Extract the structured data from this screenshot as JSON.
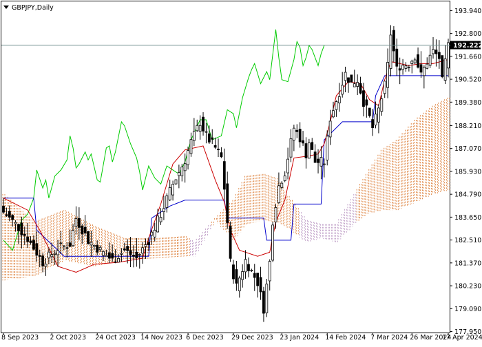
{
  "chart_title": "GBPJPY,Daily",
  "colors": {
    "background": "#ffffff",
    "candle": "#000000",
    "tenkan": "#cc0000",
    "kijun": "#0000cc",
    "chikou": "#00cc00",
    "kumo_bull": "#e08a4a",
    "kumo_bear": "#c0a0c8",
    "price_line": "#6a8a8a"
  },
  "chart_data": {
    "type": "candlestick",
    "symbol": "GBPJPY",
    "timeframe": "Daily",
    "indicators": [
      "Ichimoku Kinko Hyo"
    ],
    "ylim": [
      177.9,
      194.4
    ],
    "y_ticks": [
      "193.940",
      "192.800",
      "191.660",
      "190.520",
      "189.380",
      "188.210",
      "187.070",
      "185.930",
      "184.790",
      "183.650",
      "182.510",
      "181.370",
      "180.230",
      "179.090",
      "177.950"
    ],
    "x_ticks": [
      "8 Sep 2023",
      "2 Oct 2023",
      "24 Oct 2023",
      "14 Nov 2023",
      "6 Dec 2023",
      "29 Dec 2023",
      "23 Jan 2024",
      "14 Feb 2024",
      "7 Mar 2024",
      "26 Mar 2024",
      "17 Apr 2024"
    ],
    "current_price": "192.222",
    "close_path": [
      [
        0,
        183.9
      ],
      [
        4,
        183.3
      ],
      [
        8,
        182.6
      ],
      [
        13,
        181.4
      ],
      [
        18,
        182.1
      ],
      [
        22,
        182.3
      ],
      [
        24,
        183.6
      ],
      [
        28,
        182.5
      ],
      [
        32,
        182.0
      ],
      [
        36,
        181.5
      ],
      [
        40,
        182.0
      ],
      [
        44,
        181.6
      ],
      [
        48,
        182.5
      ],
      [
        52,
        183.8
      ],
      [
        56,
        185.3
      ],
      [
        60,
        186.5
      ],
      [
        62,
        187.4
      ],
      [
        65,
        188.4
      ],
      [
        67,
        187.7
      ],
      [
        70,
        187.1
      ],
      [
        72,
        186.6
      ],
      [
        73,
        185.1
      ],
      [
        74,
        183.4
      ],
      [
        75,
        181.4
      ],
      [
        77,
        180.2
      ],
      [
        80,
        181.5
      ],
      [
        84,
        180.4
      ],
      [
        86,
        179.1
      ],
      [
        88,
        181.4
      ],
      [
        89,
        183.5
      ],
      [
        91,
        185.2
      ],
      [
        93,
        185.9
      ],
      [
        96,
        188.1
      ],
      [
        98,
        187.6
      ],
      [
        100,
        186.8
      ],
      [
        101,
        187.4
      ],
      [
        103,
        186.4
      ],
      [
        106,
        186.4
      ],
      [
        108,
        188.6
      ],
      [
        111,
        189.9
      ],
      [
        113,
        190.8
      ],
      [
        115,
        190.3
      ],
      [
        117,
        190.5
      ],
      [
        119,
        189.4
      ],
      [
        121,
        188.6
      ],
      [
        122,
        188.1
      ],
      [
        124,
        189.0
      ],
      [
        126,
        190.2
      ],
      [
        127,
        191.2
      ],
      [
        128,
        192.8
      ],
      [
        130,
        191.0
      ],
      [
        131,
        191.2
      ],
      [
        134,
        191.3
      ],
      [
        136,
        191.7
      ],
      [
        138,
        190.7
      ],
      [
        140,
        191.4
      ],
      [
        142,
        191.9
      ],
      [
        144,
        191.6
      ],
      [
        145,
        190.4
      ],
      [
        147,
        192.2
      ]
    ],
    "kijun_path": [
      [
        0,
        184.6
      ],
      [
        10,
        184.6
      ],
      [
        11,
        183.0
      ],
      [
        18,
        182.0
      ],
      [
        20,
        181.7
      ],
      [
        30,
        181.7
      ],
      [
        40,
        181.7
      ],
      [
        48,
        181.7
      ],
      [
        49,
        183.6
      ],
      [
        55,
        184.2
      ],
      [
        60,
        184.5
      ],
      [
        73,
        184.5
      ],
      [
        74,
        183.6
      ],
      [
        86,
        183.6
      ],
      [
        87,
        182.5
      ],
      [
        95,
        182.5
      ],
      [
        96,
        184.3
      ],
      [
        105,
        184.3
      ],
      [
        106,
        187.5
      ],
      [
        112,
        188.4
      ],
      [
        118,
        188.4
      ],
      [
        122,
        188.4
      ],
      [
        123,
        189.7
      ],
      [
        126,
        190.7
      ],
      [
        147,
        190.7
      ]
    ],
    "tenkan_path": [
      [
        0,
        184.6
      ],
      [
        8,
        184.0
      ],
      [
        12,
        183.0
      ],
      [
        18,
        181.2
      ],
      [
        24,
        180.9
      ],
      [
        30,
        181.3
      ],
      [
        38,
        181.4
      ],
      [
        46,
        181.6
      ],
      [
        48,
        182.6
      ],
      [
        52,
        184.3
      ],
      [
        56,
        186.3
      ],
      [
        60,
        187.0
      ],
      [
        66,
        187.2
      ],
      [
        70,
        185.5
      ],
      [
        73,
        184.4
      ],
      [
        75,
        183.0
      ],
      [
        78,
        182.0
      ],
      [
        84,
        181.7
      ],
      [
        88,
        181.9
      ],
      [
        90,
        183.4
      ],
      [
        93,
        184.5
      ],
      [
        96,
        186.6
      ],
      [
        101,
        186.7
      ],
      [
        104,
        186.8
      ],
      [
        106,
        187.3
      ],
      [
        108,
        188.4
      ],
      [
        110,
        189.7
      ],
      [
        114,
        190.4
      ],
      [
        118,
        190.3
      ],
      [
        121,
        189.5
      ],
      [
        124,
        189.2
      ],
      [
        126,
        190.5
      ],
      [
        128,
        191.4
      ],
      [
        134,
        191.2
      ],
      [
        138,
        191.3
      ],
      [
        142,
        191.3
      ],
      [
        147,
        191.5
      ]
    ],
    "chikou_path": [
      [
        0,
        182.5
      ],
      [
        3,
        182.0
      ],
      [
        6,
        183.5
      ],
      [
        8,
        183.8
      ],
      [
        10,
        184.6
      ],
      [
        11,
        186.0
      ],
      [
        13,
        185.1
      ],
      [
        14,
        185.5
      ],
      [
        15,
        184.6
      ],
      [
        17,
        185.7
      ],
      [
        19,
        186.0
      ],
      [
        21,
        186.5
      ],
      [
        22,
        187.7
      ],
      [
        23,
        187.1
      ],
      [
        24,
        186.1
      ],
      [
        25,
        186.3
      ],
      [
        27,
        186.9
      ],
      [
        28,
        186.5
      ],
      [
        29,
        186.8
      ],
      [
        31,
        185.5
      ],
      [
        32,
        185.4
      ],
      [
        34,
        187.1
      ],
      [
        35,
        187.2
      ],
      [
        36,
        186.4
      ],
      [
        37,
        186.9
      ],
      [
        39,
        188.4
      ],
      [
        40,
        188.2
      ],
      [
        42,
        187.3
      ],
      [
        44,
        186.6
      ],
      [
        45,
        185.9
      ],
      [
        46,
        185.0
      ],
      [
        48,
        186.2
      ],
      [
        50,
        185.6
      ],
      [
        52,
        185.3
      ],
      [
        54,
        186.2
      ],
      [
        56,
        186.0
      ],
      [
        58,
        185.8
      ],
      [
        60,
        186.4
      ],
      [
        62,
        187.5
      ],
      [
        65,
        188.5
      ],
      [
        67,
        188.5
      ],
      [
        69,
        187.5
      ],
      [
        72,
        187.7
      ],
      [
        74,
        189.0
      ],
      [
        76,
        188.8
      ],
      [
        77,
        188.1
      ],
      [
        79,
        189.6
      ],
      [
        81,
        190.6
      ],
      [
        82,
        191.0
      ],
      [
        83,
        191.3
      ],
      [
        85,
        190.3
      ],
      [
        87,
        190.9
      ],
      [
        88,
        190.5
      ],
      [
        90,
        193.0
      ],
      [
        91,
        191.6
      ],
      [
        92,
        190.5
      ],
      [
        94,
        190.4
      ],
      [
        96,
        191.5
      ],
      [
        97,
        192.4
      ],
      [
        98,
        192.1
      ],
      [
        99,
        191.2
      ],
      [
        100,
        191.6
      ],
      [
        101,
        192.2
      ],
      [
        102,
        192.0
      ],
      [
        104,
        191.2
      ],
      [
        105,
        191.8
      ],
      [
        106,
        192.2
      ]
    ],
    "cloud_path": [
      [
        0,
        180.5,
        184.8
      ],
      [
        10,
        180.7,
        183.4
      ],
      [
        20,
        181.5,
        184.0
      ],
      [
        30,
        181.2,
        183.2
      ],
      [
        40,
        181.5,
        182.6
      ],
      [
        50,
        181.6,
        182.6
      ],
      [
        60,
        181.7,
        182.7
      ],
      [
        63,
        181.7,
        182.4
      ],
      [
        70,
        183.5,
        183.6
      ],
      [
        76,
        182.5,
        184.5
      ],
      [
        80,
        183.3,
        185.7
      ],
      [
        86,
        183.5,
        185.8
      ],
      [
        90,
        183.4,
        185.6
      ],
      [
        94,
        183.1,
        184.7
      ],
      [
        100,
        182.4,
        183.5
      ],
      [
        105,
        182.6,
        183.3
      ],
      [
        110,
        182.4,
        183.3
      ],
      [
        116,
        183.3,
        184.8
      ],
      [
        120,
        183.8,
        185.8
      ],
      [
        125,
        184.0,
        187.0
      ],
      [
        130,
        184.0,
        187.5
      ],
      [
        136,
        184.4,
        188.5
      ],
      [
        142,
        184.8,
        189.2
      ],
      [
        147,
        185.0,
        189.6
      ]
    ]
  }
}
